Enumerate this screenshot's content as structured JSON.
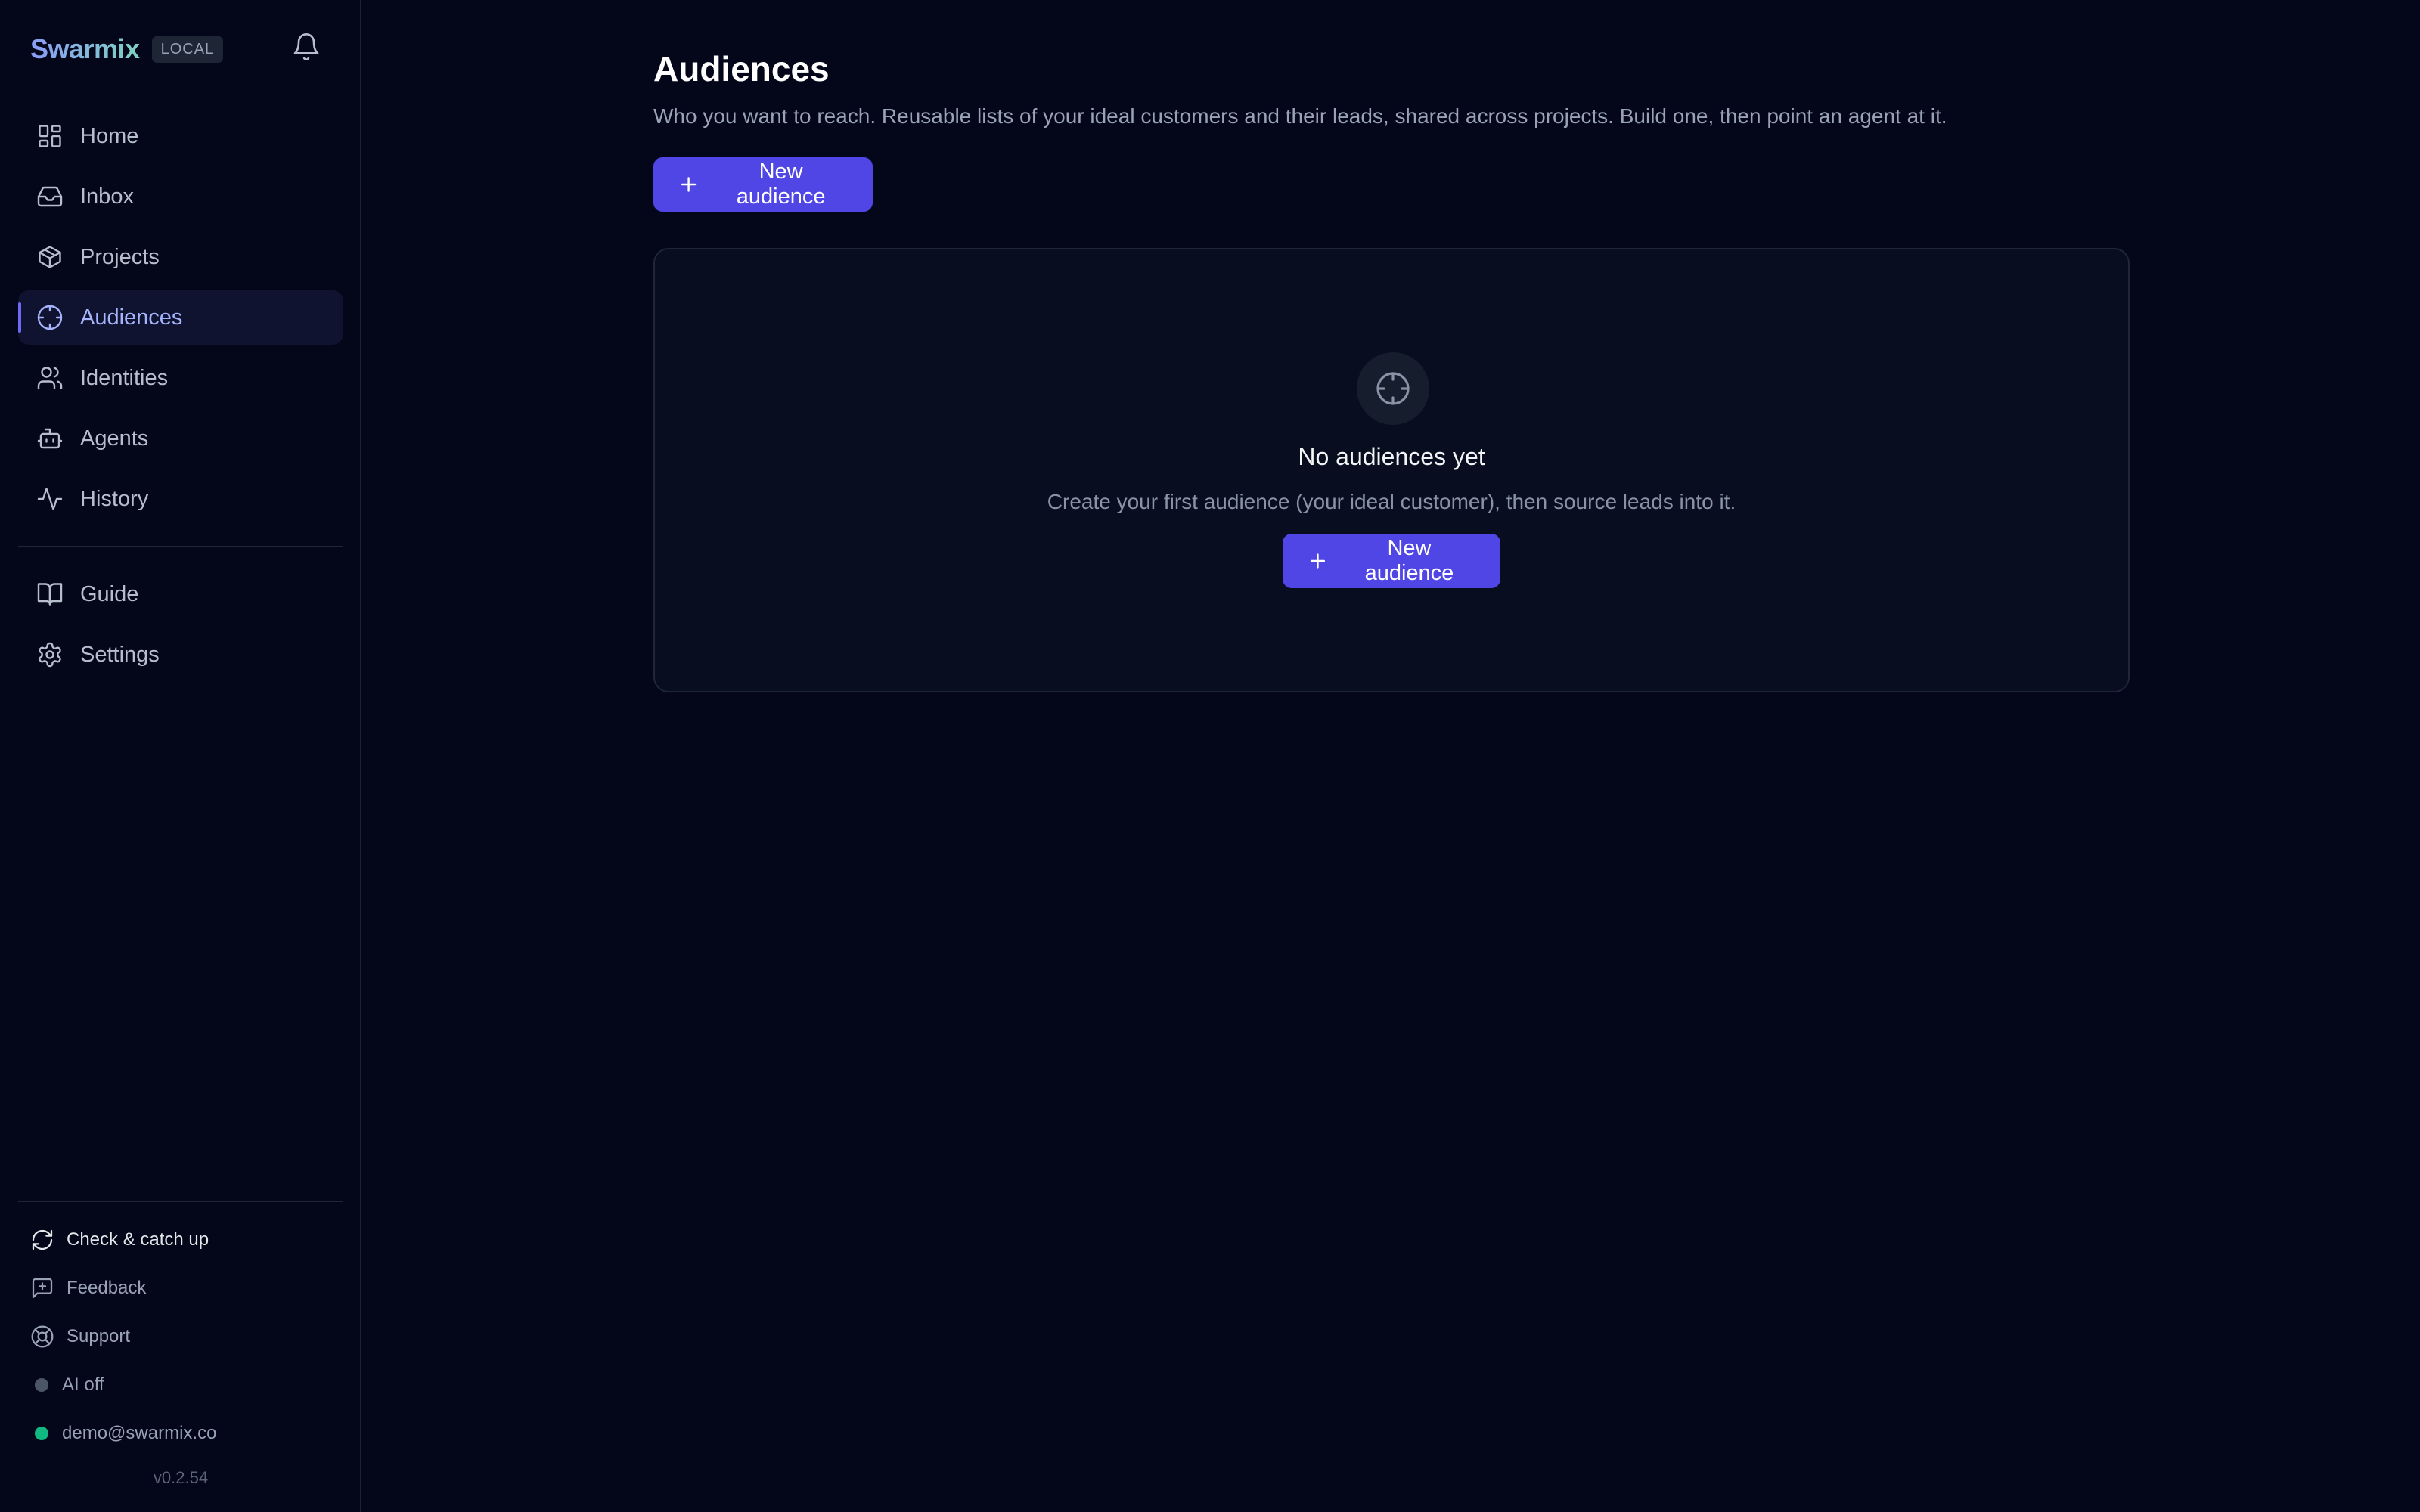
{
  "app": {
    "brand": "Swarmix",
    "env_badge": "LOCAL",
    "brand_gradient": [
      "#8b9cf8",
      "#7dd3c0"
    ],
    "accent": "#4f46e5"
  },
  "sidebar": {
    "items": [
      {
        "label": "Home",
        "icon": "home-grid-icon"
      },
      {
        "label": "Inbox",
        "icon": "inbox-icon"
      },
      {
        "label": "Projects",
        "icon": "package-icon"
      },
      {
        "label": "Audiences",
        "icon": "crosshair-icon",
        "active": true
      },
      {
        "label": "Identities",
        "icon": "users-icon"
      },
      {
        "label": "Agents",
        "icon": "bot-icon"
      },
      {
        "label": "History",
        "icon": "activity-icon"
      }
    ],
    "secondary": [
      {
        "label": "Guide",
        "icon": "book-icon"
      },
      {
        "label": "Settings",
        "icon": "gear-icon"
      }
    ],
    "footer": {
      "check_label": "Check & catch up",
      "feedback_label": "Feedback",
      "support_label": "Support",
      "ai_status": "AI off",
      "ai_status_color": "#4b5563",
      "user_email": "demo@swarmix.co",
      "user_status_color": "#10b981",
      "version": "v0.2.54"
    }
  },
  "main": {
    "title": "Audiences",
    "subtitle": "Who you want to reach. Reusable lists of your ideal customers and their leads, shared across projects. Build one, then point an agent at it.",
    "new_button_label": "New audience",
    "empty_state": {
      "icon": "crosshair-icon",
      "title": "No audiences yet",
      "subtitle": "Create your first audience (your ideal customer), then source leads into it.",
      "button_label": "New audience"
    }
  }
}
